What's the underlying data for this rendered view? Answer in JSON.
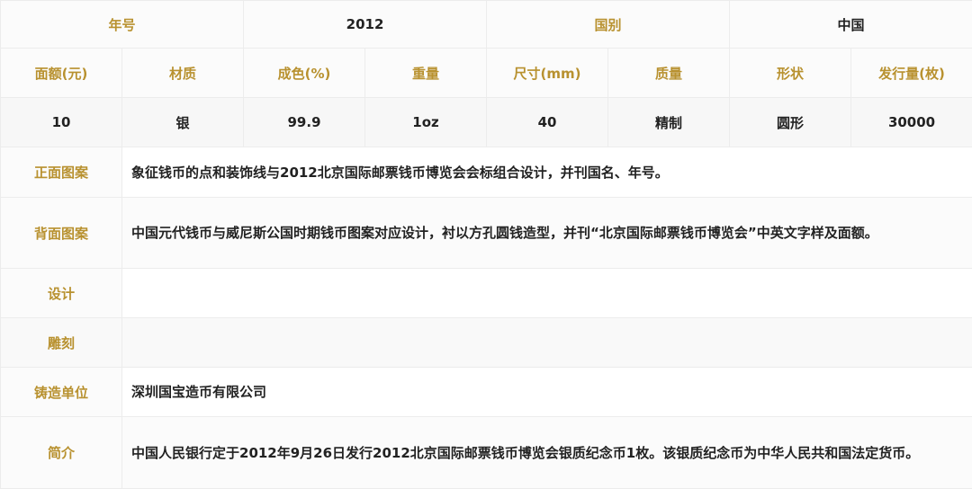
{
  "header": {
    "year_label": "年号",
    "year_value": "2012",
    "country_label": "国别",
    "country_value": "中国"
  },
  "spec_columns": [
    "面额(元)",
    "材质",
    "成色(%)",
    "重量",
    "尺寸(mm)",
    "质量",
    "形状",
    "发行量(枚)"
  ],
  "spec_values": [
    "10",
    "银",
    "99.9",
    "1oz",
    "40",
    "精制",
    "圆形",
    "30000"
  ],
  "details": {
    "obverse_label": "正面图案",
    "obverse_text": "象征钱币的点和装饰线与2012北京国际邮票钱币博览会会标组合设计，并刊国名、年号。",
    "reverse_label": "背面图案",
    "reverse_text": "中国元代钱币与威尼斯公国时期钱币图案对应设计，衬以方孔圆钱造型，并刊“北京国际邮票钱币博览会”中英文字样及面额。",
    "designer_label": "设计",
    "designer_text": "",
    "engraver_label": "雕刻",
    "engraver_text": "",
    "mint_label": "铸造单位",
    "mint_text": "深圳国宝造币有限公司",
    "intro_label": "简介",
    "intro_text": "中国人民银行定于2012年9月26日发行2012北京国际邮票钱币博览会银质纪念币1枚。该银质纪念币为中华人民共和国法定货币。"
  }
}
